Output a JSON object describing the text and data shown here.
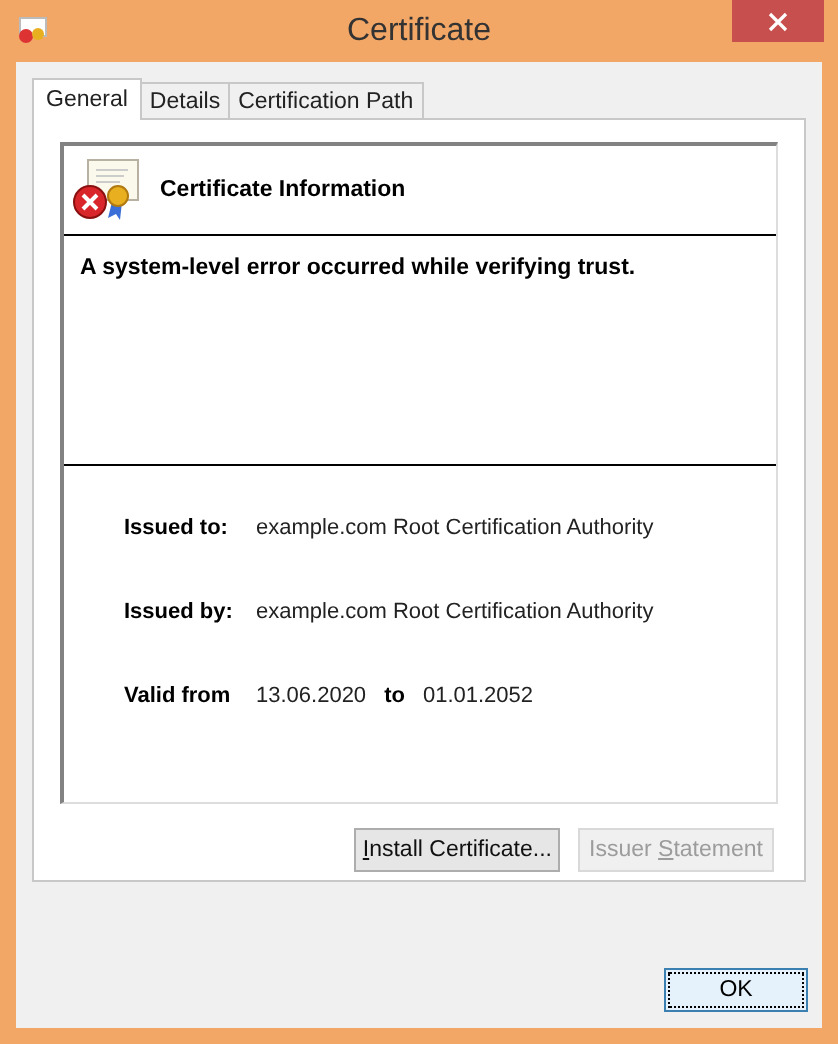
{
  "window": {
    "title": "Certificate"
  },
  "tabs": [
    {
      "label": "General",
      "selected": true
    },
    {
      "label": "Details",
      "selected": false
    },
    {
      "label": "Certification Path",
      "selected": false
    }
  ],
  "info": {
    "heading": "Certificate Information",
    "message": "A system-level error occurred while verifying trust.",
    "issued_to_label": "Issued to:",
    "issued_to": "example.com Root Certification Authority",
    "issued_by_label": "Issued by:",
    "issued_by": "example.com Root Certification Authority",
    "valid_from_label": "Valid from",
    "valid_from": "13.06.2020",
    "valid_to_label": "to",
    "valid_to": "01.01.2052"
  },
  "buttons": [
    {
      "access_key": "I",
      "label_rest": "nstall Certificate...",
      "disabled": false
    },
    {
      "label_start": "Issuer ",
      "access_key": "S",
      "label_rest": "tatement",
      "disabled": true
    }
  ],
  "ok_button": {
    "label": "OK",
    "focused": true
  }
}
